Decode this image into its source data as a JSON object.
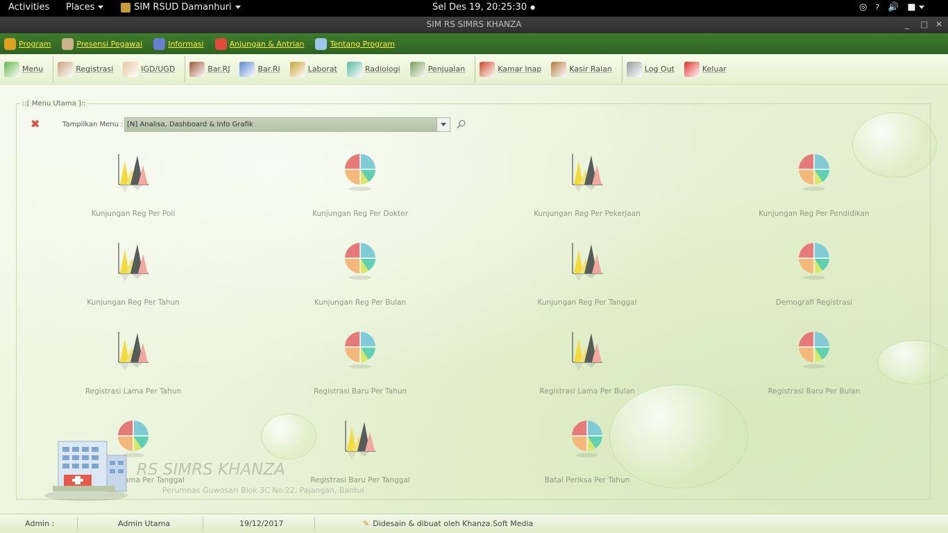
{
  "topbar": {
    "activities": "Activities",
    "places": "Places",
    "app_name": "SIM RSUD Damanhuri",
    "clock": "Sel Des 19, 20:25:30"
  },
  "window": {
    "title": "SIM RS SIMRS KHANZA"
  },
  "menubar": [
    {
      "label": "Program",
      "icon": "key-icon",
      "color": "#e0a020"
    },
    {
      "label": "Presensi Pegawai",
      "icon": "employee-icon",
      "color": "#c9b48a"
    },
    {
      "label": "Informasi",
      "icon": "books-icon",
      "color": "#6a7fd0"
    },
    {
      "label": "Anjungan & Antrian",
      "icon": "lifebuoy-icon",
      "color": "#e04a3a"
    },
    {
      "label": "Tentang Program",
      "icon": "notepad-icon",
      "color": "#9cc7e8"
    }
  ],
  "toolbar": [
    {
      "label": "Menu",
      "icon": "home-icon",
      "color": "#5fb84a"
    },
    {
      "sep": true
    },
    {
      "label": "Registrasi",
      "icon": "registration-icon",
      "color": "#c8a27a"
    },
    {
      "label": "IGD/UGD",
      "icon": "doctor-icon",
      "color": "#e6c6a0"
    },
    {
      "sep": true
    },
    {
      "label": "Bar.RJ",
      "icon": "medicine-cart-icon",
      "color": "#a05a3a"
    },
    {
      "label": "Bar.RI",
      "icon": "pills-icon",
      "color": "#5a88d0"
    },
    {
      "label": "Laborat",
      "icon": "microscope-icon",
      "color": "#c9a13a"
    },
    {
      "label": "Radiologi",
      "icon": "radiology-icon",
      "color": "#5ab8a0"
    },
    {
      "label": "Penjualan",
      "icon": "cart-icon",
      "color": "#7aa05a"
    },
    {
      "sep": true
    },
    {
      "label": "Kamar Inap",
      "icon": "house-icon",
      "color": "#d04a2a"
    },
    {
      "label": "Kasir Ralan",
      "icon": "cashier-icon",
      "color": "#b07a40"
    },
    {
      "sep": true
    },
    {
      "label": "Log Out",
      "icon": "logout-icon",
      "color": "#9a9a9a"
    },
    {
      "label": "Keluar",
      "icon": "exit-icon",
      "color": "#e0302a"
    }
  ],
  "panel": {
    "title": "::[ Menu Utama ]::",
    "filter_label": "Tampilkan Menu :",
    "filter_value": "[N] Analisa, Dashboard & Info Grafik"
  },
  "menu_items": [
    {
      "label": "Kunjungan Reg Per Poli",
      "icon": "bar-chart-icon"
    },
    {
      "label": "Kunjungan Reg Per Dokter",
      "icon": "pie-chart-icon"
    },
    {
      "label": "Kunjungan Reg Per Pekerjaan",
      "icon": "bar-chart-icon"
    },
    {
      "label": "Kunjungan Reg Per Pendidikan",
      "icon": "pie-chart-icon"
    },
    {
      "label": "Kunjungan Reg Per Tahun",
      "icon": "bar-chart-icon"
    },
    {
      "label": "Kunjungan Reg Per Bulan",
      "icon": "pie-chart-icon"
    },
    {
      "label": "Kunjungan Reg Per Tanggal",
      "icon": "bar-chart-icon"
    },
    {
      "label": "Demografi Registrasi",
      "icon": "pie-chart-icon"
    },
    {
      "label": "Registrasi Lama Per Tahun",
      "icon": "bar-chart-icon"
    },
    {
      "label": "Registrasi Baru Per Tahun",
      "icon": "pie-chart-icon"
    },
    {
      "label": "Registrasi Lama Per Bulan",
      "icon": "bar-chart-icon"
    },
    {
      "label": "Registrasi Baru Per Bulan",
      "icon": "pie-chart-icon"
    },
    {
      "label": "Registrasi Lama Per Tanggal",
      "icon": "pie-chart-icon"
    },
    {
      "label": "Registrasi Baru Per Tanggal",
      "icon": "bar-chart-icon"
    },
    {
      "label": "Batal Periksa Per Tahun",
      "icon": "pie-chart-icon"
    }
  ],
  "watermark": {
    "title": "RS SIMRS KHANZA",
    "address": "Perumnas Guwosari Blok 3C No.22, Pajangan, Bantul"
  },
  "statusbar": {
    "user": "Admin :",
    "role": "Admin Utama",
    "date": "19/12/2017",
    "credit": "Didesain & dibuat oleh Khanza.Soft Media"
  }
}
